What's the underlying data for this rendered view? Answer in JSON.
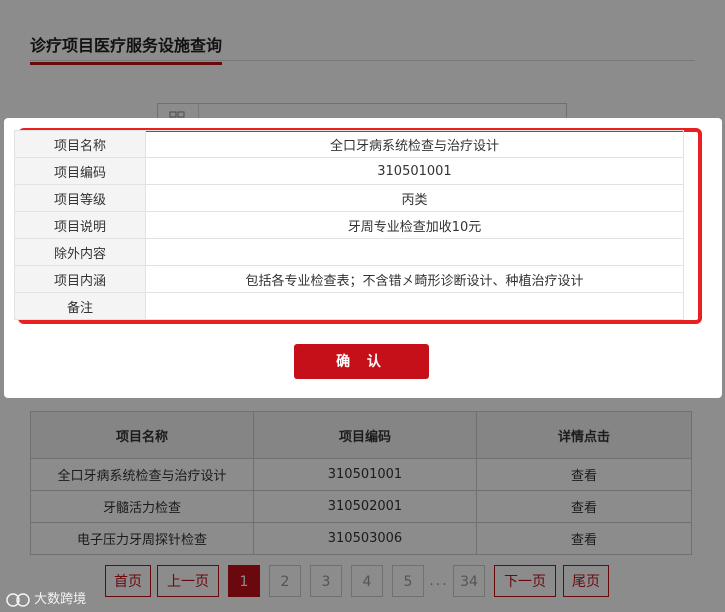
{
  "page": {
    "title": "诊疗项目医疗服务设施查询"
  },
  "detail": {
    "rows": [
      {
        "label": "项目名称",
        "value": "全口牙病系统检查与治疗设计"
      },
      {
        "label": "项目编码",
        "value": "310501001"
      },
      {
        "label": "项目等级",
        "value": "丙类"
      },
      {
        "label": "项目说明",
        "value": "牙周专业检查加收10元"
      },
      {
        "label": "除外内容",
        "value": ""
      },
      {
        "label": "项目内涵",
        "value": "包括各专业检查表；不含错㐅畸形诊断设计、种植治疗设计"
      },
      {
        "label": "备注",
        "value": ""
      }
    ],
    "confirm_label": "确 认"
  },
  "list": {
    "headers": [
      "项目名称",
      "项目编码",
      "详情点击"
    ],
    "rows": [
      {
        "name": "全口牙病系统检查与治疗设计",
        "code": "310501001",
        "action": "查看"
      },
      {
        "name": "牙髓活力检查",
        "code": "310502001",
        "action": "查看"
      },
      {
        "name": "电子压力牙周探针检查",
        "code": "310503006",
        "action": "查看"
      }
    ]
  },
  "pager": {
    "first": "首页",
    "prev": "上一页",
    "pages": [
      "1",
      "2",
      "3",
      "4",
      "5"
    ],
    "ellipsis": "...",
    "last_page": "34",
    "next": "下一页",
    "last": "尾页",
    "current": "1"
  },
  "watermark": {
    "text": "大数跨境"
  },
  "colors": {
    "accent": "#c0121b",
    "highlight_frame": "#e8201f"
  }
}
